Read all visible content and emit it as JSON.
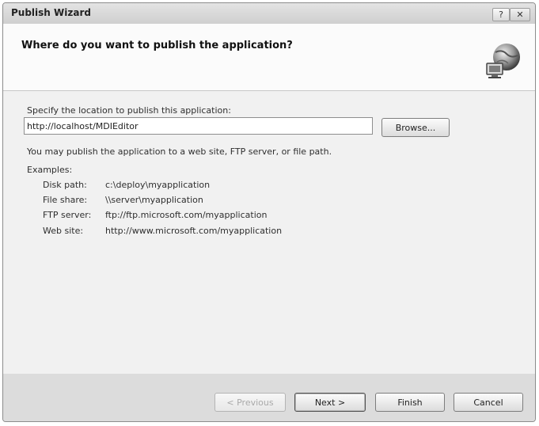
{
  "window": {
    "title": "Publish Wizard",
    "help_glyph": "?",
    "close_glyph": "✕"
  },
  "header": {
    "heading": "Where do you want to publish the application?",
    "icon": "globe-computer-icon"
  },
  "form": {
    "location_label": "Specify the location to publish this application:",
    "location_value": "http://localhost/MDIEditor",
    "browse_label": "Browse...",
    "hint": "You may publish the application to a web site, FTP server, or file path.",
    "examples_label": "Examples:",
    "examples": [
      {
        "kind": "Disk path:",
        "value": "c:\\deploy\\myapplication"
      },
      {
        "kind": "File share:",
        "value": "\\\\server\\myapplication"
      },
      {
        "kind": "FTP server:",
        "value": "ftp://ftp.microsoft.com/myapplication"
      },
      {
        "kind": "Web site:",
        "value": "http://www.microsoft.com/myapplication"
      }
    ]
  },
  "footer": {
    "previous_label": "< Previous",
    "next_label": "Next >",
    "finish_label": "Finish",
    "cancel_label": "Cancel"
  }
}
